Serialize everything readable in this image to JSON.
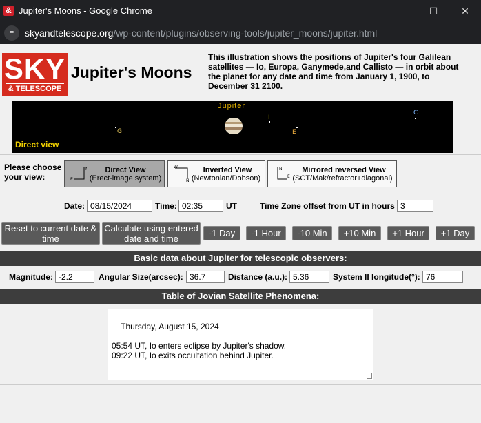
{
  "window": {
    "title": "Jupiter's Moons - Google Chrome",
    "app_icon": "&"
  },
  "browser": {
    "url_host": "skyandtelescope.org",
    "url_path": "/wp-content/plugins/observing-tools/jupiter_moons/jupiter.html"
  },
  "logo": {
    "line1": "SKY",
    "line2": "& TELESCOPE"
  },
  "header": {
    "title": "Jupiter's Moons",
    "intro": "This illustration shows the positions of Jupiter's four Galilean satellites — Io, Europa, Ganymede,and Callisto — in orbit about the planet for any date and time from January 1, 1900, to December 31 2100."
  },
  "sky_view": {
    "planet_label": "Jupiter",
    "mode_label": "Direct view",
    "moons": [
      {
        "letter": "G",
        "color": "#f0d060"
      },
      {
        "letter": "I",
        "color": "#e0d000"
      },
      {
        "letter": "E",
        "color": "#f0b040"
      },
      {
        "letter": "C",
        "color": "#7fb8ff"
      }
    ]
  },
  "view_choice": {
    "prompt": "Please choose your view:",
    "options": [
      {
        "title": "Direct View",
        "subtitle": "(Erect-image system)",
        "selected": true,
        "axis_top": "N",
        "axis_side": "E"
      },
      {
        "title": "Inverted View",
        "subtitle": "(Newtonian/Dobson)",
        "selected": false,
        "axis_top": "W",
        "axis_side": "N"
      },
      {
        "title": "Mirrored reversed View",
        "subtitle": "(SCT/Mak/refractor+diagonal)",
        "selected": false,
        "axis_top": "N",
        "axis_side": "E"
      }
    ]
  },
  "datetime": {
    "date_label": "Date:",
    "date_value": "08/15/2024",
    "time_label": "Time:",
    "time_value": "02:35",
    "time_unit": "UT",
    "tz_label": "Time Zone offset from UT in hours",
    "tz_value": "3"
  },
  "actions": {
    "reset": "Reset to current date & time",
    "calculate": "Calculate using entered date and time",
    "minus_day": "-1 Day",
    "minus_hour": "-1 Hour",
    "minus_10min": "-10 Min",
    "plus_10min": "+10 Min",
    "plus_hour": "+1 Hour",
    "plus_day": "+1 Day"
  },
  "basic_data": {
    "heading": "Basic data about Jupiter for telescopic observers:",
    "magnitude_label": "Magnitude:",
    "magnitude_value": "-2.2",
    "size_label": "Angular Size(arcsec):",
    "size_value": "36.7",
    "distance_label": "Distance (a.u.):",
    "distance_value": "5.36",
    "longitude_label": "System II longitude(°):",
    "longitude_value": "76"
  },
  "phenomena": {
    "heading": "Table of Jovian Satellite Phenomena:",
    "text": "Thursday, August 15, 2024\n\n05:54 UT, Io enters eclipse by Jupiter's shadow.\n09:22 UT, Io exits occultation behind Jupiter."
  }
}
